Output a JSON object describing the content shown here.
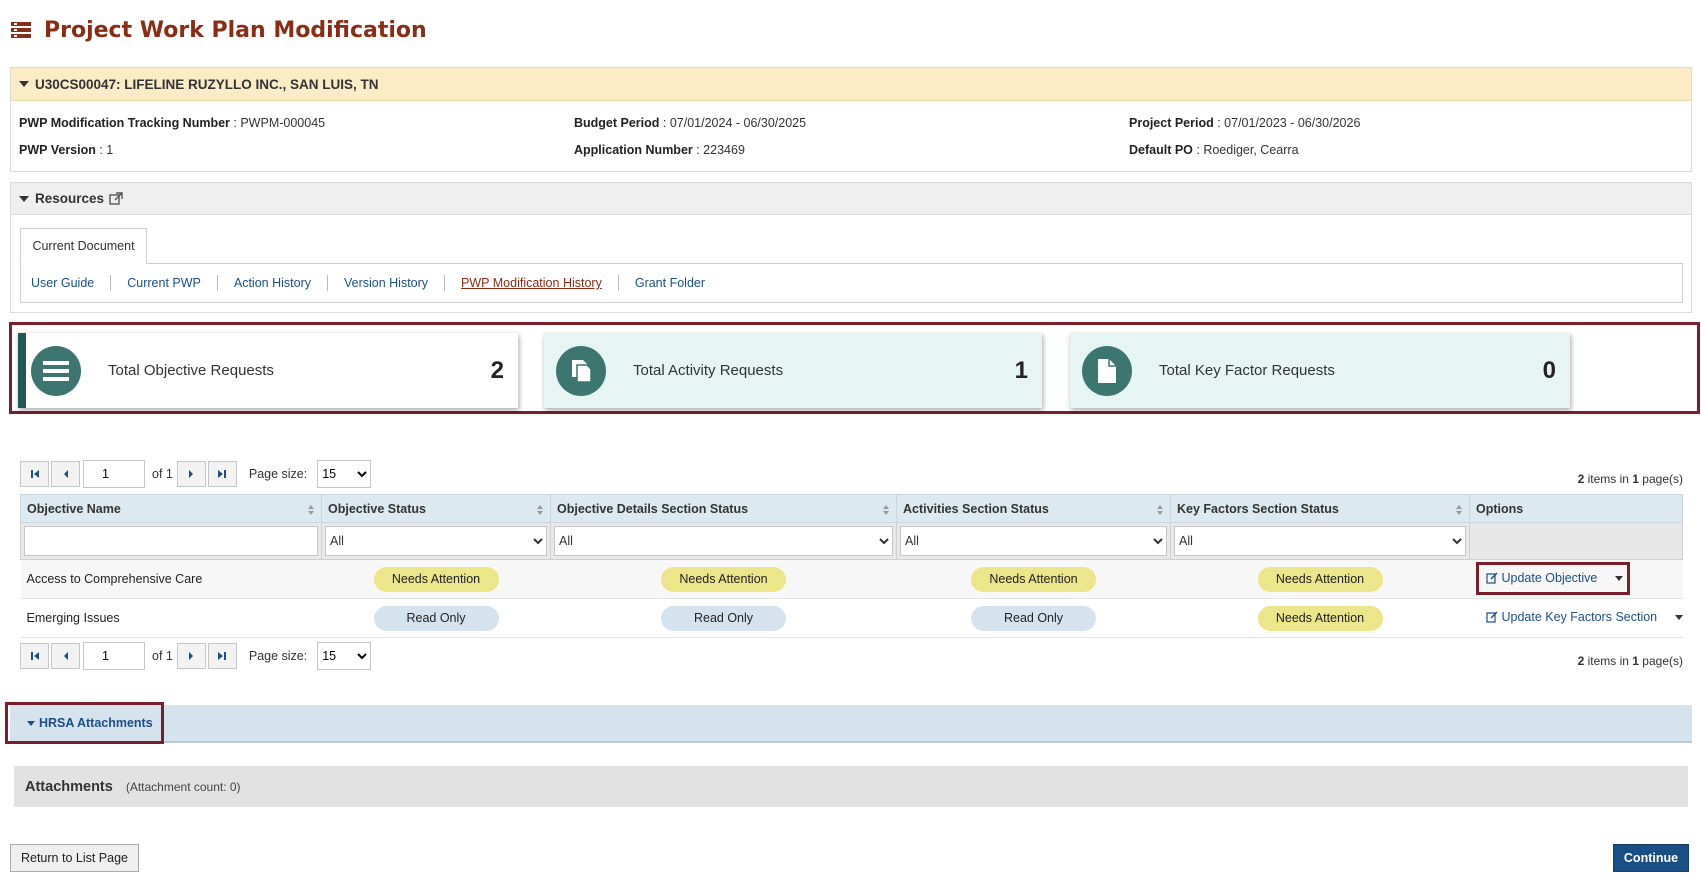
{
  "page": {
    "title": "Project Work Plan Modification"
  },
  "grant": {
    "header": "U30CS00047: LIFELINE RUZYLLO INC., SAN LUIS, TN",
    "tracking_label": "PWP Modification Tracking Number",
    "tracking_value": " : PWPM-000045",
    "version_label": "PWP Version",
    "version_value": " : 1",
    "budget_label": "Budget Period",
    "budget_value": " : 07/01/2024 - 06/30/2025",
    "application_label": "Application Number",
    "application_value": " : 223469",
    "project_label": "Project Period",
    "project_value": " : 07/01/2023 - 06/30/2026",
    "po_label": "Default PO",
    "po_value": " : Roediger, Cearra"
  },
  "resources": {
    "header": "Resources",
    "tab": "Current Document",
    "links": [
      "User Guide",
      "Current PWP",
      "Action History",
      "Version History",
      "PWP Modification History",
      "Grant Folder"
    ]
  },
  "cards": [
    {
      "label": "Total Objective Requests",
      "count": "2",
      "icon": "list-icon"
    },
    {
      "label": "Total Activity Requests",
      "count": "1",
      "icon": "documents-icon"
    },
    {
      "label": "Total Key Factor Requests",
      "count": "0",
      "icon": "file-icon"
    }
  ],
  "pager": {
    "page": "1",
    "of_text": "of 1",
    "page_size_label": "Page size:",
    "page_size": "15",
    "items_count": "2",
    "items_mid": " items in ",
    "pages_count": "1",
    "items_suffix": " page(s)"
  },
  "table": {
    "columns": [
      "Objective Name",
      "Objective Status",
      "Objective Details Section Status",
      "Activities Section Status",
      "Key Factors Section Status",
      "Options"
    ],
    "filter_all": "All",
    "rows": [
      {
        "name": "Access to Comprehensive Care",
        "objective_status": "Needs Attention",
        "details_status": "Needs Attention",
        "activities_status": "Needs Attention",
        "key_factors_status": "Needs Attention",
        "option": "Update Objective"
      },
      {
        "name": "Emerging Issues",
        "objective_status": "Read Only",
        "details_status": "Read Only",
        "activities_status": "Read Only",
        "key_factors_status": "Needs Attention",
        "option": "Update Key Factors Section"
      }
    ]
  },
  "hrsa": {
    "label": "HRSA Attachments"
  },
  "attachments": {
    "title": "Attachments",
    "count_text": "(Attachment count: 0)"
  },
  "footer": {
    "return_label": "Return to List Page",
    "continue_label": "Continue"
  },
  "colors": {
    "title": "#8b2d14",
    "accent_teal": "#3d7670",
    "highlight_outline": "#7a1f2b",
    "link": "#1b4f86",
    "needs_attention": "#ede58a",
    "read_only": "#d5e3ef"
  }
}
